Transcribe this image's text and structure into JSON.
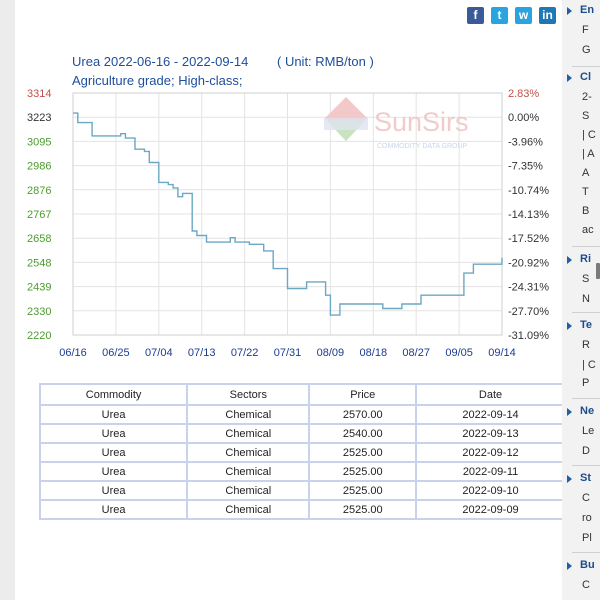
{
  "share": {
    "facebook": "f",
    "twitter": "t",
    "wechat": "w",
    "linkedin": "in"
  },
  "chart_data": {
    "type": "line",
    "title": "Urea 2022-06-16 - 2022-09-14",
    "unit": "( Unit: RMB/ton )",
    "subtitle": "Agriculture grade; High-class;",
    "x_labels": [
      "06/16",
      "06/25",
      "07/04",
      "07/13",
      "07/22",
      "07/31",
      "08/09",
      "08/18",
      "08/27",
      "09/05",
      "09/14"
    ],
    "y_left": [
      "3314",
      "3223",
      "3095",
      "2986",
      "2876",
      "2767",
      "2658",
      "2548",
      "2439",
      "2330",
      "2220"
    ],
    "y_right": [
      "2.83%",
      "0.00%",
      "-3.96%",
      "-7.35%",
      "-10.74%",
      "-14.13%",
      "-17.52%",
      "-20.92%",
      "-24.31%",
      "-27.70%",
      "-31.09%"
    ],
    "ylim": [
      2220,
      3314
    ],
    "x": [
      "2022-06-16",
      "2022-06-17",
      "2022-06-19",
      "2022-06-20",
      "2022-06-26",
      "2022-06-27",
      "2022-06-29",
      "2022-07-01",
      "2022-07-02",
      "2022-07-04",
      "2022-07-06",
      "2022-07-07",
      "2022-07-08",
      "2022-07-09",
      "2022-07-11",
      "2022-07-12",
      "2022-07-14",
      "2022-07-15",
      "2022-07-17",
      "2022-07-19",
      "2022-07-20",
      "2022-07-21",
      "2022-07-23",
      "2022-07-24",
      "2022-07-26",
      "2022-07-28",
      "2022-07-31",
      "2022-08-02",
      "2022-08-04",
      "2022-08-06",
      "2022-08-08",
      "2022-08-09",
      "2022-08-11",
      "2022-08-14",
      "2022-08-18",
      "2022-08-20",
      "2022-08-22",
      "2022-08-24",
      "2022-08-28",
      "2022-09-04",
      "2022-09-06",
      "2022-09-08",
      "2022-09-13",
      "2022-09-14"
    ],
    "values": [
      3223,
      3180,
      3180,
      3120,
      3130,
      3110,
      3060,
      3050,
      3000,
      2910,
      2900,
      2885,
      2845,
      2860,
      2690,
      2670,
      2640,
      2640,
      2640,
      2660,
      2640,
      2640,
      2630,
      2630,
      2600,
      2520,
      2430,
      2430,
      2460,
      2460,
      2400,
      2310,
      2360,
      2360,
      2360,
      2340,
      2340,
      2360,
      2400,
      2400,
      2500,
      2540,
      2540,
      2570
    ],
    "watermark": "SunSirs",
    "watermark_sub": "COMMODITY DATA GROUP",
    "colors": {
      "line": "#6aa8c4",
      "left_axis_green": "#4c9c2e",
      "top_red": "#c0504d",
      "title": "#1f4e9a",
      "label_blue": "#1b3d8f"
    }
  },
  "table": {
    "headers": [
      "Commodity",
      "Sectors",
      "Price",
      "Date"
    ],
    "rows": [
      [
        "Urea",
        "Chemical",
        "2570.00",
        "2022-09-14"
      ],
      [
        "Urea",
        "Chemical",
        "2540.00",
        "2022-09-13"
      ],
      [
        "Urea",
        "Chemical",
        "2525.00",
        "2022-09-12"
      ],
      [
        "Urea",
        "Chemical",
        "2525.00",
        "2022-09-11"
      ],
      [
        "Urea",
        "Chemical",
        "2525.00",
        "2022-09-10"
      ],
      [
        "Urea",
        "Chemical",
        "2525.00",
        "2022-09-09"
      ]
    ]
  },
  "sidebar": {
    "sections": [
      {
        "title": "En",
        "lines": [
          "F",
          "G"
        ]
      },
      {
        "title": "Cl",
        "lines": [
          "2-",
          "S",
          "| C",
          "| A",
          "A",
          "T",
          "B",
          "ac"
        ]
      },
      {
        "title": "Ri",
        "lines": [
          "S",
          "N"
        ]
      },
      {
        "title": "Te",
        "lines": [
          "R",
          "| C",
          "P"
        ]
      },
      {
        "title": "Ne",
        "lines": [
          "Le",
          "D"
        ]
      },
      {
        "title": "St",
        "lines": [
          "C",
          "ro",
          "Pl"
        ]
      },
      {
        "title": "Bu",
        "lines": [
          "C"
        ]
      }
    ]
  }
}
